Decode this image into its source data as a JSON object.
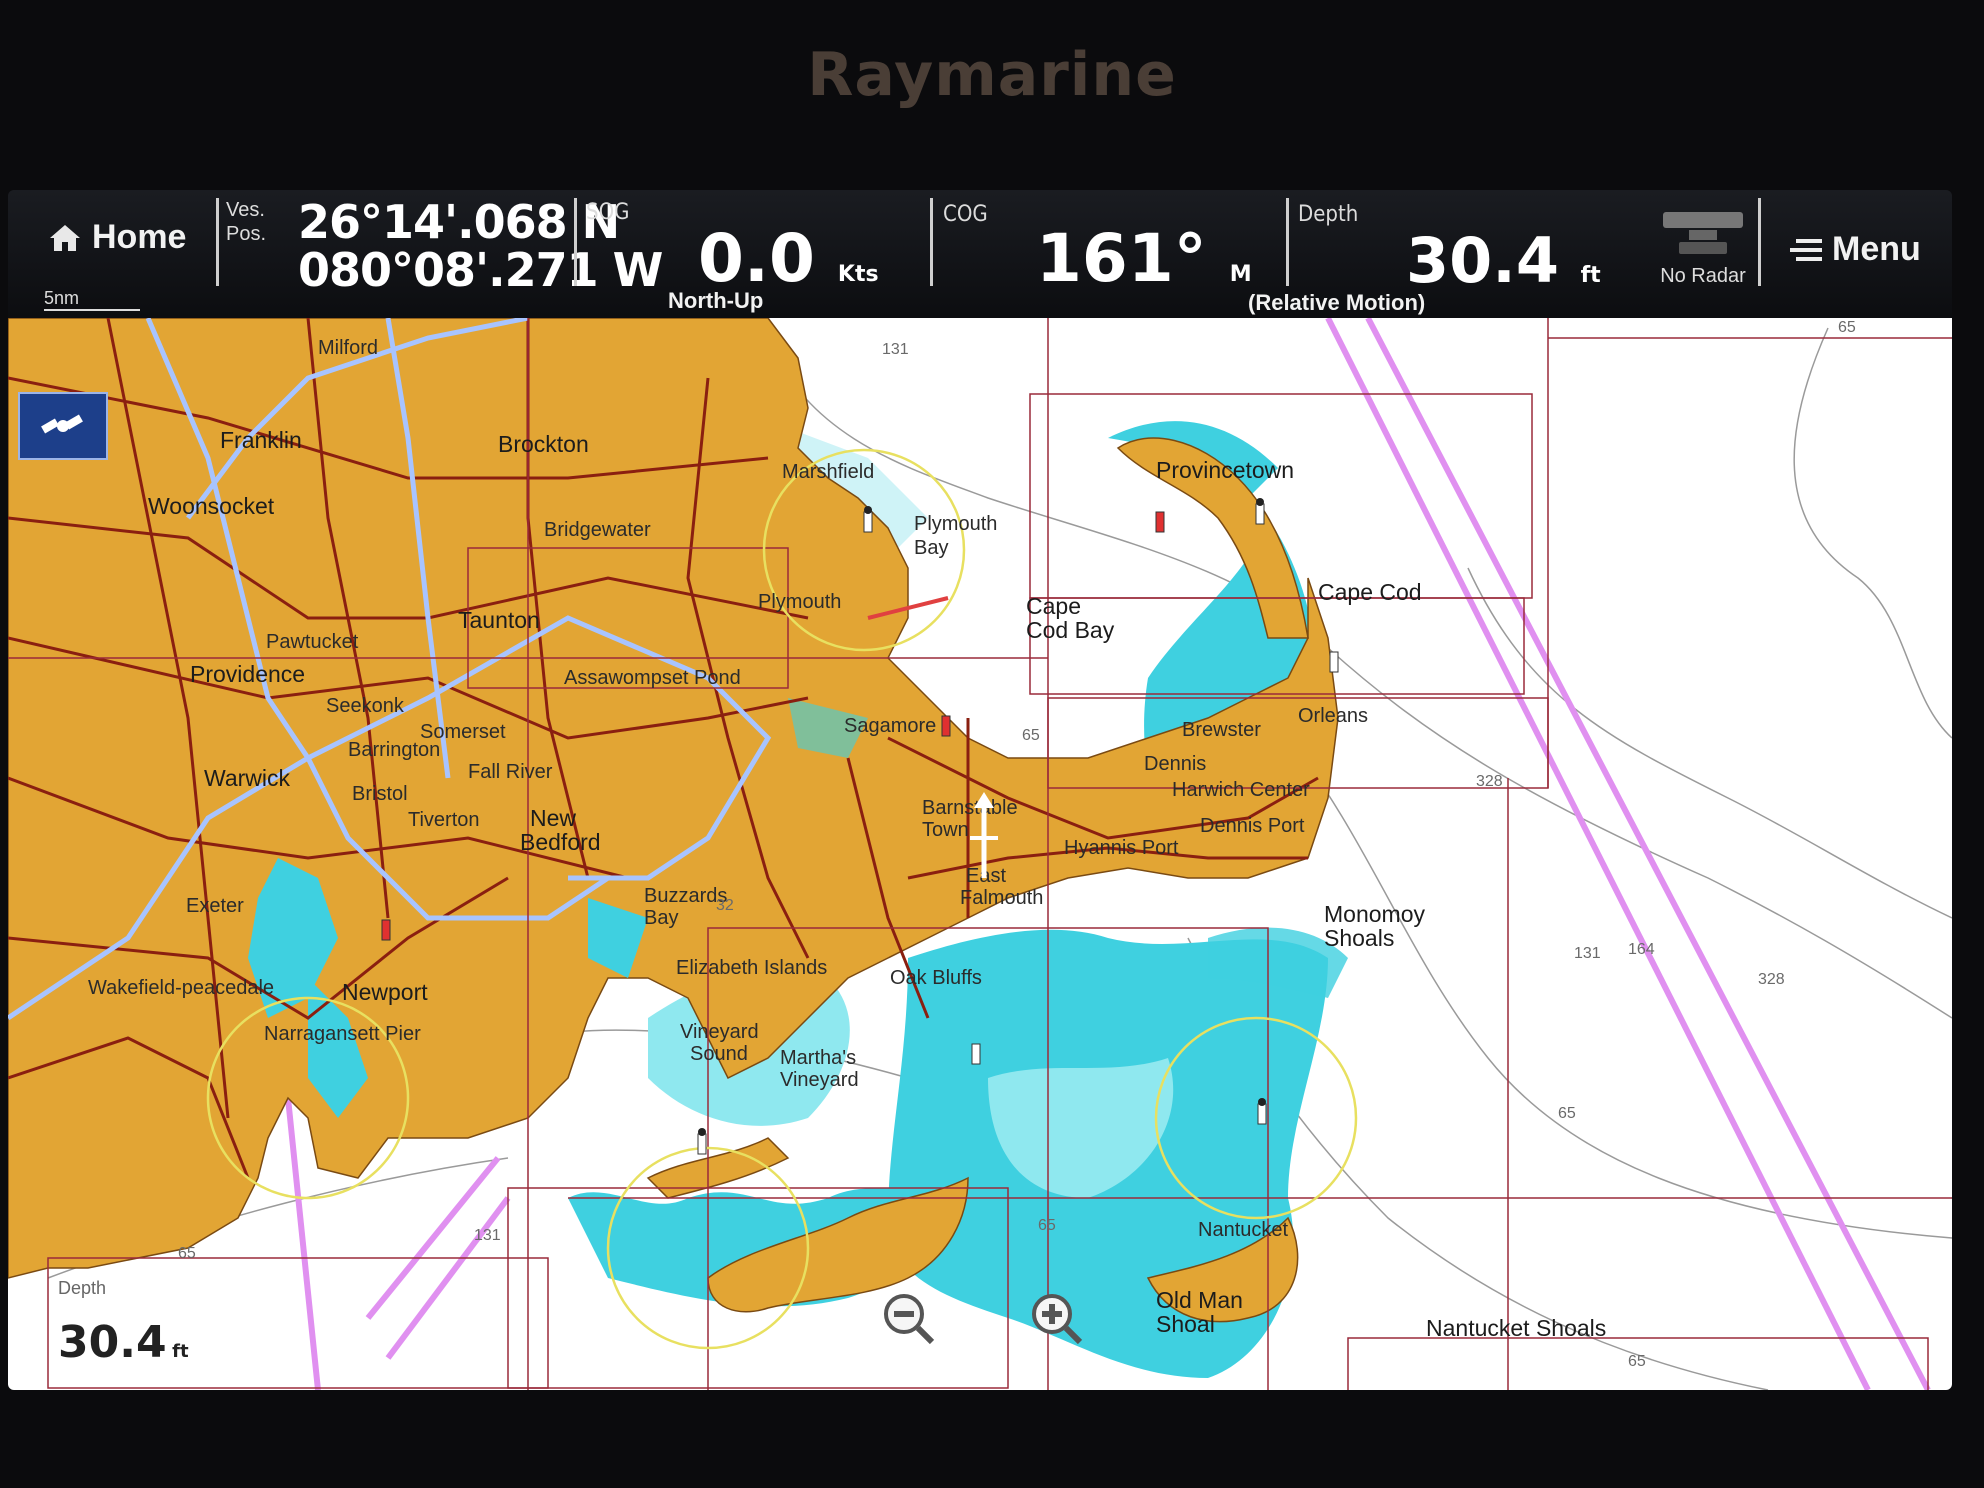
{
  "device": {
    "brand": "Raymarine"
  },
  "databar": {
    "home_label": "Home",
    "scale_label": "5nm",
    "vessel_position": {
      "label_line1": "Ves.",
      "label_line2": "Pos.",
      "lat": "26°14'.068 N",
      "lon": "080°08'.271 W"
    },
    "sog": {
      "label": "SOG",
      "value": "0.0",
      "unit": "Kts",
      "mode": "North-Up"
    },
    "cog": {
      "label": "COG",
      "value": "161°",
      "unit": "M"
    },
    "depth": {
      "label": "Depth",
      "value": "30.4",
      "unit": "ft",
      "mode": "(Relative Motion)"
    },
    "radar_label": "No Radar",
    "menu_label": "Menu"
  },
  "map": {
    "places": {
      "franklin": "Franklin",
      "brockton": "Brockton",
      "woonsocket": "Woonsocket",
      "taunton": "Taunton",
      "providence": "Providence",
      "pawtucket": "Pawtucket",
      "seekonk": "Seekonk",
      "somerset": "Somerset",
      "barrington": "Barrington",
      "warwick": "Warwick",
      "bristol": "Bristol",
      "tiverton": "Tiverton",
      "fall_river": "Fall River",
      "new": "New",
      "bedford": "Bedford",
      "marshfield": "Marshfield",
      "bridgewater": "Bridgewater",
      "plymouth": "Plymouth",
      "plymouth_bay_1": "Plymouth",
      "plymouth_bay_2": "Bay",
      "assawompset": "Assawompset Pond",
      "sagamore": "Sagamore",
      "provincetown": "Provincetown",
      "cape_cod_bay_1": "Cape",
      "cape_cod_bay_2": "Cod Bay",
      "cape_cod": "Cape Cod",
      "brewster": "Brewster",
      "orleans": "Orleans",
      "dennis": "Dennis",
      "harwich": "Harwich Center",
      "dennis_port": "Dennis Port",
      "barnstable_1": "Barnstable",
      "barnstable_2": "Town",
      "hyannis": "Hyannis Port",
      "east_falmouth_1": "East",
      "east_falmouth_2": "Falmouth",
      "buzzards_1": "Buzzards",
      "buzzards_2": "Bay",
      "elizabeth": "Elizabeth Islands",
      "oak_bluffs": "Oak Bluffs",
      "vineyard_sound_1": "Vineyard",
      "vineyard_sound_2": "Sound",
      "marthas_1": "Martha's",
      "marthas_2": "Vineyard",
      "monomoy_1": "Monomoy",
      "monomoy_2": "Shoals",
      "nantucket": "Nantucket",
      "old_man_1": "Old Man",
      "old_man_2": "Shoal",
      "nantucket_shoals": "Nantucket Shoals",
      "newport": "Newport",
      "narragansett": "Narragansett Pier",
      "exeter": "Exeter",
      "wakefield": "Wakefield-peacedale",
      "marshfield_top": "Milford"
    },
    "soundings": [
      "131",
      "65",
      "328",
      "131",
      "164",
      "328",
      "65",
      "65",
      "65",
      "131",
      "65",
      "32",
      "65"
    ],
    "depth_corner": {
      "label": "Depth",
      "value": "30.4",
      "unit": "ft"
    }
  },
  "colors": {
    "land": "#e2a534",
    "shallow": "#3fd0e0",
    "deep_shallow": "#8fe8ef",
    "sea": "#ffffff",
    "roads": "#8a1f10",
    "highway": "#a8c4ff",
    "chart_border": "#9a2a3a",
    "lane": "#e090f0"
  }
}
